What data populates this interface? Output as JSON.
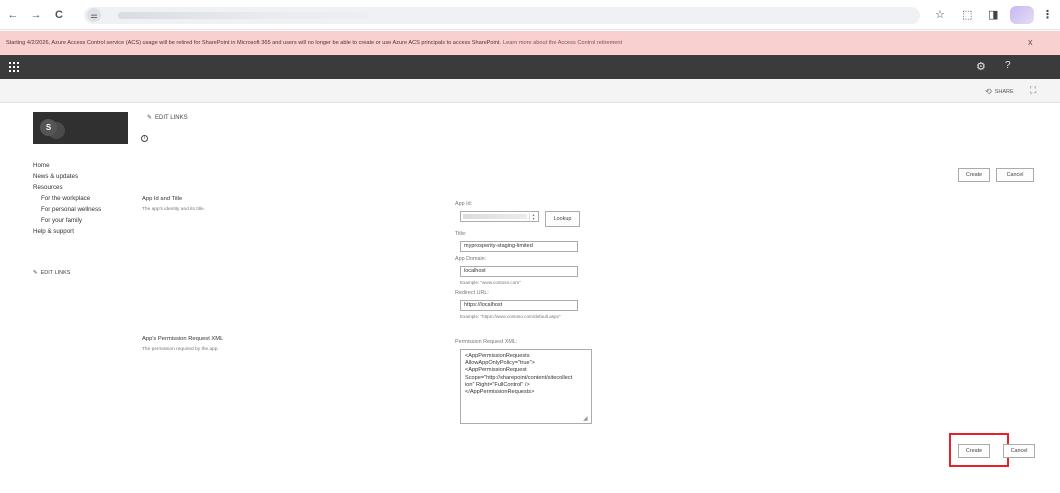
{
  "browser": {
    "back_glyph": "←",
    "forward_glyph": "→",
    "reload_glyph": "C",
    "site_info_glyph": "⚌",
    "star_glyph": "☆",
    "extensions_glyph": "⬚",
    "sidepanel_glyph": "◨",
    "menu_glyph": "⋮"
  },
  "banner": {
    "message": "Starting 4/2/2026, Azure Access Control service (ACS) usage will be retired for SharePoint in Microsoft 365 and users will no longer be able to create or use Azure ACS principals to access SharePoint.",
    "link_text": "Learn more about the Access Control retirement",
    "close_glyph": "x"
  },
  "suite_bar": {
    "settings_glyph": "⚙",
    "help_glyph": "?"
  },
  "ribbon": {
    "share_label": "SHARE",
    "share_glyph": "⟲",
    "focus_glyph": "⛶"
  },
  "site": {
    "logo_letter": "S",
    "edit_links_label": "EDIT LINKS",
    "info_glyph": "i"
  },
  "leftnav": {
    "items": [
      {
        "label": "Home",
        "level": 0
      },
      {
        "label": "News & updates",
        "level": 0
      },
      {
        "label": "Resources",
        "level": 0
      },
      {
        "label": "For the workplace",
        "level": 1
      },
      {
        "label": "For personal wellness",
        "level": 1
      },
      {
        "label": "For your family",
        "level": 1
      },
      {
        "label": "Help & support",
        "level": 0
      }
    ],
    "edit_links_label": "EDIT LINKS"
  },
  "form": {
    "top_create_label": "Create",
    "top_cancel_label": "Cancel",
    "app_section": {
      "title": "App Id and Title",
      "description": "The app's identity and its title."
    },
    "app_id_label": "App Id:",
    "lookup_label": "Lookup",
    "title_label": "Title:",
    "title_value": "myprosperity-staging-limited",
    "app_domain_label": "App Domain:",
    "app_domain_value": "localhost",
    "app_domain_example": "Example: \"www.contoso.com\"",
    "redirect_label": "Redirect URL:",
    "redirect_value": "https://localhost",
    "redirect_example": "Example: \"https://www.contoso.com/default.aspx\"",
    "permission_section": {
      "title": "App's Permission Request XML",
      "description": "The permission required by the app."
    },
    "permission_label": "Permission Request XML:",
    "permission_xml": "<AppPermissionRequests\nAllowAppOnlyPolicy=\"true\">\n<AppPermissionRequest\nScope=\"http://sharepoint/content/sitecollect\nion\" Right=\"FullControl\" />\n</AppPermissionRequests>",
    "bottom_create_label": "Create",
    "bottom_cancel_label": "Cancel"
  },
  "colors": {
    "banner_bg": "#f8d0d0",
    "suite_bar_bg": "#3b3b3b",
    "highlight_border": "#e8202a"
  }
}
